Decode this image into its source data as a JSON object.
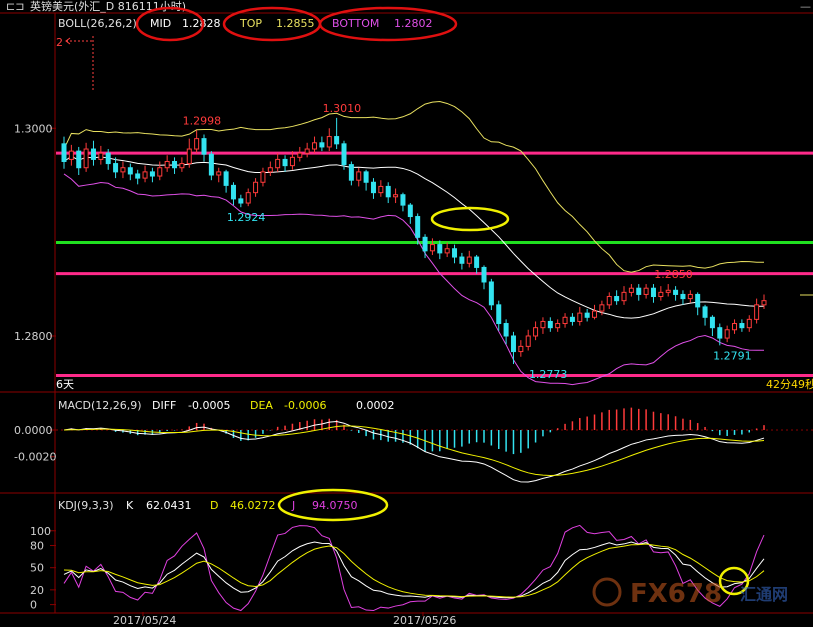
{
  "window": {
    "title": "英镑美元(外汇_D 816111小时)"
  },
  "boll": {
    "header": "BOLL(26,26,2)",
    "mid_label": "MID",
    "mid_value": "1.2828",
    "top_label": "TOP",
    "top_value": "1.2855",
    "bottom_label": "BOTTOM",
    "bottom_value": "1.2802"
  },
  "macd": {
    "header": "MACD(12,26,9)",
    "diff_label": "DIFF",
    "diff_value": "-0.0005",
    "dea_label": "DEA",
    "dea_value": "-0.0006",
    "macd_value": "0.0002"
  },
  "kdj": {
    "header": "KDJ(9,3,3)",
    "k_label": "K",
    "k_value": "62.0431",
    "d_label": "D",
    "d_value": "46.0272",
    "j_label": "J",
    "j_value": "94.0750"
  },
  "annotations": {
    "marker_2": "2",
    "days_label": "6天",
    "countdown": "42分49秒",
    "watermark": "FX678",
    "watermark_sub": "汇通网"
  },
  "colors": {
    "bull": "#ff3b3b",
    "bear": "#33e3f0",
    "mid": "#ffffff",
    "upper": "#e8e060",
    "lower": "#e050e8",
    "hline_pink": "#ff2a8a",
    "hline_green": "#20e020",
    "ellipse_red": "#e01010",
    "ellipse_yellow": "#f0f000",
    "axis": "#8b0000",
    "diff": "#ffffff",
    "dea": "#f0f000",
    "k": "#ffffff",
    "d": "#f0f000",
    "j": "#e040e0"
  },
  "chart_data": [
    {
      "type": "candlestick",
      "title": "BOLL(26,26,2)",
      "y_ticks": [
        "1.3000",
        "1.2800"
      ],
      "ylim": [
        1.2748,
        1.311
      ],
      "x_tick_labels": [
        "2017/05/24",
        "2017/05/26"
      ],
      "price_labels": [
        {
          "text": "1.2998",
          "index": 18,
          "price": 1.2998
        },
        {
          "text": "1.3010",
          "index": 37,
          "price": 1.301
        },
        {
          "text": "1.2924",
          "index": 24,
          "price": 1.2924
        },
        {
          "text": "1.2773",
          "index": 65,
          "price": 1.2773
        },
        {
          "text": "1.2850",
          "index": 82,
          "price": 1.285
        },
        {
          "text": "1.2791",
          "index": 90,
          "price": 1.2791
        }
      ],
      "horizontal_lines": [
        {
          "price": 1.2976,
          "color": "pink"
        },
        {
          "price": 1.289,
          "color": "green"
        },
        {
          "price": 1.286,
          "color": "pink"
        },
        {
          "price": 1.2762,
          "color": "pink"
        }
      ],
      "candles": [
        [
          1.2985,
          1.2968,
          1.2992,
          1.2961
        ],
        [
          1.297,
          1.2978,
          1.2984,
          1.2964
        ],
        [
          1.2978,
          1.2962,
          1.2982,
          1.2955
        ],
        [
          1.2962,
          1.298,
          1.2986,
          1.2958
        ],
        [
          1.298,
          1.297,
          1.2988,
          1.2964
        ],
        [
          1.297,
          1.2976,
          1.2983,
          1.2965
        ],
        [
          1.2976,
          1.2966,
          1.298,
          1.296
        ],
        [
          1.2966,
          1.2958,
          1.2972,
          1.2952
        ],
        [
          1.2958,
          1.2962,
          1.2968,
          1.2952
        ],
        [
          1.2962,
          1.2956,
          1.2966,
          1.295
        ],
        [
          1.2956,
          1.2952,
          1.296,
          1.2946
        ],
        [
          1.2952,
          1.2958,
          1.2964,
          1.2948
        ],
        [
          1.2958,
          1.2954,
          1.2962,
          1.2948
        ],
        [
          1.2954,
          1.2962,
          1.2968,
          1.295
        ],
        [
          1.2962,
          1.2968,
          1.2974,
          1.2958
        ],
        [
          1.2968,
          1.2962,
          1.2972,
          1.2956
        ],
        [
          1.2962,
          1.2966,
          1.2972,
          1.2958
        ],
        [
          1.2966,
          1.298,
          1.299,
          1.2962
        ],
        [
          1.298,
          1.299,
          1.2998,
          1.2976
        ],
        [
          1.299,
          1.2975,
          1.2994,
          1.2968
        ],
        [
          1.2975,
          1.2955,
          1.2978,
          1.295
        ],
        [
          1.2955,
          1.2958,
          1.2962,
          1.2948
        ],
        [
          1.2958,
          1.2945,
          1.296,
          1.2938
        ],
        [
          1.2945,
          1.2932,
          1.2948,
          1.2926
        ],
        [
          1.2932,
          1.2928,
          1.2936,
          1.2924
        ],
        [
          1.2928,
          1.2938,
          1.2942,
          1.2925
        ],
        [
          1.2938,
          1.2948,
          1.2952,
          1.2934
        ],
        [
          1.2948,
          1.2958,
          1.2962,
          1.2944
        ],
        [
          1.2958,
          1.2962,
          1.2968,
          1.2954
        ],
        [
          1.2962,
          1.297,
          1.2976,
          1.2958
        ],
        [
          1.297,
          1.2964,
          1.2974,
          1.2958
        ],
        [
          1.2964,
          1.2972,
          1.2978,
          1.296
        ],
        [
          1.2972,
          1.2976,
          1.2982,
          1.2968
        ],
        [
          1.2976,
          1.298,
          1.2986,
          1.2972
        ],
        [
          1.298,
          1.2986,
          1.2992,
          1.2976
        ],
        [
          1.2986,
          1.2982,
          1.2992,
          1.2978
        ],
        [
          1.2982,
          1.2992,
          1.3,
          1.2978
        ],
        [
          1.2992,
          1.2985,
          1.301,
          1.298
        ],
        [
          1.2985,
          1.2965,
          1.2988,
          1.296
        ],
        [
          1.2965,
          1.295,
          1.2968,
          1.2945
        ],
        [
          1.295,
          1.2958,
          1.2962,
          1.2944
        ],
        [
          1.2958,
          1.2948,
          1.296,
          1.294
        ],
        [
          1.2948,
          1.2938,
          1.2952,
          1.2932
        ],
        [
          1.2938,
          1.2944,
          1.295,
          1.2934
        ],
        [
          1.2944,
          1.2934,
          1.2948,
          1.2928
        ],
        [
          1.2934,
          1.2936,
          1.2942,
          1.2928
        ],
        [
          1.2936,
          1.2926,
          1.2938,
          1.292
        ],
        [
          1.2926,
          1.2915,
          1.2928,
          1.2908
        ],
        [
          1.2915,
          1.2895,
          1.2918,
          1.2888
        ],
        [
          1.2895,
          1.2882,
          1.2898,
          1.2875
        ],
        [
          1.2882,
          1.2888,
          1.2894,
          1.2878
        ],
        [
          1.2888,
          1.288,
          1.2892,
          1.2874
        ],
        [
          1.288,
          1.2884,
          1.289,
          1.2876
        ],
        [
          1.2884,
          1.2876,
          1.2888,
          1.287
        ],
        [
          1.2876,
          1.287,
          1.288,
          1.2864
        ],
        [
          1.287,
          1.2876,
          1.2882,
          1.2866
        ],
        [
          1.2876,
          1.2866,
          1.2878,
          1.286
        ],
        [
          1.2866,
          1.2852,
          1.2868,
          1.2845
        ],
        [
          1.2852,
          1.283,
          1.2855,
          1.2825
        ],
        [
          1.283,
          1.2812,
          1.2834,
          1.2805
        ],
        [
          1.2812,
          1.28,
          1.2816,
          1.2792
        ],
        [
          1.28,
          1.2785,
          1.2804,
          1.2773
        ],
        [
          1.2785,
          1.279,
          1.2796,
          1.278
        ],
        [
          1.279,
          1.28,
          1.2806,
          1.2786
        ],
        [
          1.28,
          1.2808,
          1.2814,
          1.2796
        ],
        [
          1.2808,
          1.2814,
          1.2818,
          1.2802
        ],
        [
          1.2814,
          1.2808,
          1.2818,
          1.2804
        ],
        [
          1.2808,
          1.2812,
          1.2816,
          1.2804
        ],
        [
          1.2812,
          1.2818,
          1.2822,
          1.2808
        ],
        [
          1.2818,
          1.2814,
          1.2822,
          1.281
        ],
        [
          1.2814,
          1.2822,
          1.2828,
          1.281
        ],
        [
          1.2822,
          1.2818,
          1.2826,
          1.2814
        ],
        [
          1.2818,
          1.2824,
          1.283,
          1.2816
        ],
        [
          1.2824,
          1.283,
          1.2834,
          1.282
        ],
        [
          1.283,
          1.2838,
          1.2842,
          1.2826
        ],
        [
          1.2838,
          1.2834,
          1.2844,
          1.283
        ],
        [
          1.2834,
          1.2842,
          1.2848,
          1.283
        ],
        [
          1.2842,
          1.2846,
          1.285,
          1.2838
        ],
        [
          1.2846,
          1.284,
          1.285,
          1.2834
        ],
        [
          1.284,
          1.2846,
          1.285,
          1.2836
        ],
        [
          1.2846,
          1.2838,
          1.285,
          1.2832
        ],
        [
          1.2838,
          1.2842,
          1.2848,
          1.2834
        ],
        [
          1.2842,
          1.2844,
          1.285,
          1.2838
        ],
        [
          1.2844,
          1.284,
          1.2848,
          1.2834
        ],
        [
          1.284,
          1.2836,
          1.2844,
          1.283
        ],
        [
          1.2836,
          1.284,
          1.2844,
          1.2832
        ],
        [
          1.284,
          1.2828,
          1.2842,
          1.282
        ],
        [
          1.2828,
          1.2818,
          1.283,
          1.281
        ],
        [
          1.2818,
          1.2808,
          1.282,
          1.28
        ],
        [
          1.2808,
          1.2798,
          1.2812,
          1.2791
        ],
        [
          1.2798,
          1.2806,
          1.281,
          1.2794
        ],
        [
          1.2806,
          1.2812,
          1.2816,
          1.2802
        ],
        [
          1.2812,
          1.2808,
          1.2816,
          1.2804
        ],
        [
          1.2808,
          1.2816,
          1.282,
          1.2804
        ],
        [
          1.2816,
          1.283,
          1.2836,
          1.2812
        ],
        [
          1.283,
          1.2834,
          1.284,
          1.2826
        ]
      ]
    },
    {
      "type": "macd",
      "title": "MACD(12,26,9)",
      "y_ticks": [
        "0.0000",
        "-0.0020"
      ],
      "ylim": [
        -0.0045,
        0.0015
      ]
    },
    {
      "type": "kdj",
      "title": "KDJ(9,3,3)",
      "y_ticks": [
        "100",
        "80",
        "50",
        "20",
        "0"
      ],
      "ylim": [
        -10,
        120
      ]
    }
  ]
}
